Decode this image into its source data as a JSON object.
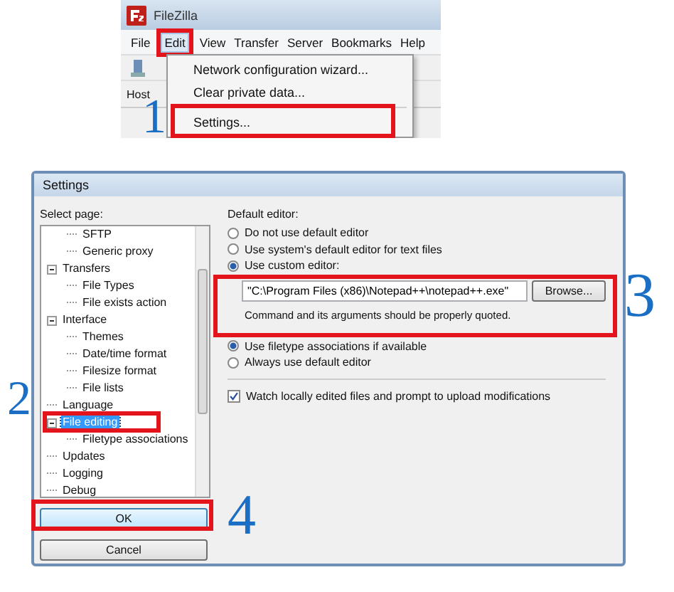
{
  "app_window": {
    "title": "FileZilla",
    "host_label": "Host",
    "menu": [
      {
        "label": "File",
        "selected": false
      },
      {
        "label": "Edit",
        "selected": true
      },
      {
        "label": "View",
        "selected": false
      },
      {
        "label": "Transfer",
        "selected": false
      },
      {
        "label": "Server",
        "selected": false
      },
      {
        "label": "Bookmarks",
        "selected": false
      },
      {
        "label": "Help",
        "selected": false
      }
    ],
    "dropdown": [
      {
        "kind": "item",
        "label": "Network configuration wizard..."
      },
      {
        "kind": "item",
        "label": "Clear private data..."
      },
      {
        "kind": "separator"
      },
      {
        "kind": "item",
        "label": "Settings..."
      }
    ]
  },
  "settings_dialog": {
    "title": "Settings",
    "select_page_label": "Select page:",
    "tree": [
      {
        "children": [
          {
            "label": "SFTP",
            "selected": false
          },
          {
            "label": "Generic proxy",
            "selected": false
          }
        ]
      },
      {
        "label": "Transfers",
        "expanded": true,
        "selected": false,
        "children": [
          {
            "label": "File Types",
            "selected": false
          },
          {
            "label": "File exists action",
            "selected": false
          }
        ]
      },
      {
        "label": "Interface",
        "expanded": true,
        "selected": false,
        "children": [
          {
            "label": "Themes",
            "selected": false
          },
          {
            "label": "Date/time format",
            "selected": false
          },
          {
            "label": "Filesize format",
            "selected": false
          },
          {
            "label": "File lists",
            "selected": false
          }
        ]
      },
      {
        "label": "Language",
        "selected": false
      },
      {
        "label": "File editing",
        "expanded": true,
        "selected": true,
        "children": [
          {
            "label": "Filetype associations",
            "selected": false
          }
        ]
      },
      {
        "label": "Updates",
        "selected": false
      },
      {
        "label": "Logging",
        "selected": false
      },
      {
        "label": "Debug",
        "selected": false
      }
    ],
    "ok_button": "OK",
    "cancel_button": "Cancel",
    "default_editor_label": "Default editor:",
    "editor_options": [
      {
        "label": "Do not use default editor",
        "selected": false
      },
      {
        "label": "Use system's default editor for text files",
        "selected": false
      },
      {
        "label": "Use custom editor:",
        "selected": true
      }
    ],
    "custom_editor_path": "\"C:\\Program Files (x86)\\Notepad++\\notepad++.exe\"",
    "browse_button": "Browse...",
    "hint": "Command and its arguments should be properly quoted.",
    "association_options": [
      {
        "label": "Use filetype associations if available",
        "selected": true
      },
      {
        "label": "Always use default editor",
        "selected": false
      }
    ],
    "watch": {
      "label": "Watch locally edited files and prompt to upload modifications",
      "checked": true
    }
  },
  "annotations": [
    {
      "label": "1"
    },
    {
      "label": "2"
    },
    {
      "label": "3"
    },
    {
      "label": "4"
    }
  ]
}
